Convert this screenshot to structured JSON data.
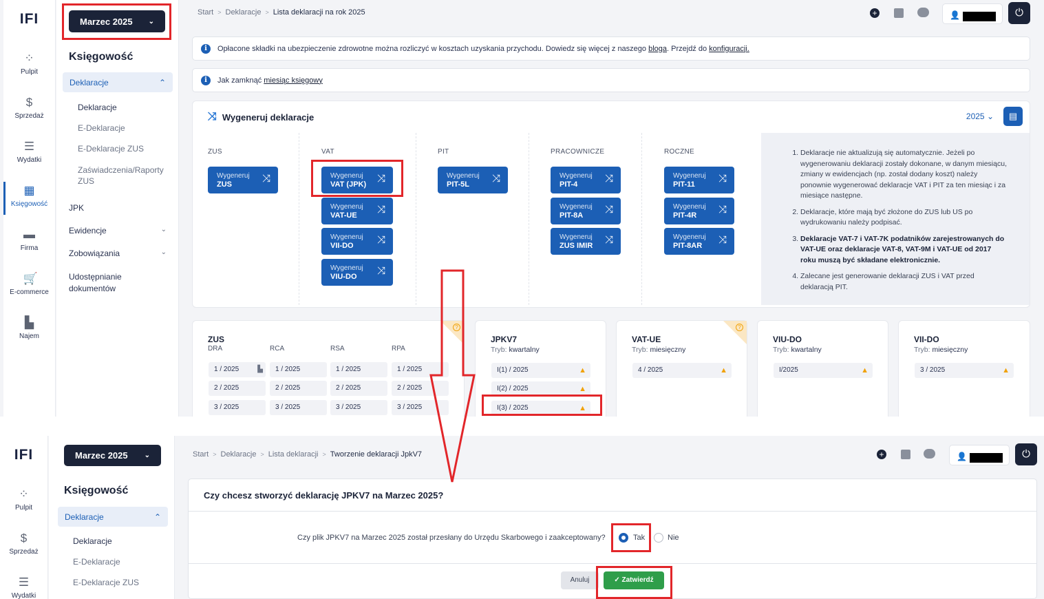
{
  "top": {
    "logo": "IFI",
    "month_button": "Marzec 2025",
    "rail": [
      {
        "label": "Pulpit",
        "icon": "dashboard-icon"
      },
      {
        "label": "Sprzedaż",
        "icon": "invoice-icon"
      },
      {
        "label": "Wydatki",
        "icon": "receipt-icon"
      },
      {
        "label": "Księgowość",
        "icon": "accounting-icon"
      },
      {
        "label": "Firma",
        "icon": "briefcase-icon"
      },
      {
        "label": "E-commerce",
        "icon": "cart-icon"
      },
      {
        "label": "Najem",
        "icon": "building-icon"
      }
    ],
    "side_title": "Księgowość",
    "side_selected": "Deklaracje",
    "side_sub": [
      "Deklaracje",
      "E-Deklaracje",
      "E-Deklaracje ZUS",
      "Zaświadczenia/Raporty",
      "ZUS"
    ],
    "side_main": [
      "JPK",
      "Ewidencje",
      "Zobowiązania",
      "Udostępnianie",
      "dokumentów"
    ],
    "breadcrumbs": [
      "Start",
      "Deklaracje",
      "Lista deklaracji na rok 2025"
    ],
    "info1": {
      "text": "Opłacone składki na ubezpieczenie zdrowotne można rozliczyć w kosztach uzyskania przychodu. Dowiedz się więcej z naszego",
      "link1": "bloga",
      "mid": ". Przejdź do",
      "link2": "konfiguracji."
    },
    "info2": {
      "text": "Jak zamknąć",
      "link": "miesiąc księgowy"
    },
    "gen_title": "Wygeneruj deklaracje",
    "year": "2025",
    "columns": [
      "ZUS",
      "VAT",
      "PIT",
      "PRACOWNICZE",
      "ROCZNE"
    ],
    "gen_prefix": "Wygeneruj",
    "buttons": {
      "zus": [
        "ZUS"
      ],
      "vat": [
        "VAT (JPK)",
        "VAT-UE",
        "VII-DO",
        "VIU-DO"
      ],
      "pit": [
        "PIT-5L"
      ],
      "prac": [
        "PIT-4",
        "PIT-8A",
        "ZUS IMIR"
      ],
      "roczne": [
        "PIT-11",
        "PIT-4R",
        "PIT-8AR"
      ]
    },
    "notes": {
      "n1": "Deklaracje nie aktualizują się automatycznie. Jeżeli po wygenerowaniu deklaracji zostały dokonane, w danym miesiącu, zmiany w ewidencjach (np. został dodany koszt) należy ponownie wygenerować deklaracje VAT i PIT za ten miesiąc i za miesiące następne.",
      "n2": "Deklaracje, które mają być złożone do ZUS lub US po wydrukowaniu należy podpisać.",
      "n3": "Deklaracje VAT-7 i VAT-7K podatników zarejestrowanych do VAT-UE oraz deklaracje VAT-8, VAT-9M i VAT-UE od 2017 roku muszą być składane elektronicznie.",
      "n4": "Zalecane jest generowanie deklaracji ZUS i VAT przed deklaracją PIT."
    },
    "zus_card": {
      "title": "ZUS",
      "cols": [
        "DRA",
        "RCA",
        "RSA",
        "RPA"
      ],
      "rows": [
        "1 / 2025",
        "2 / 2025",
        "3 / 2025"
      ]
    },
    "jpk_card": {
      "title": "JPKV7",
      "mode_label": "Tryb:",
      "mode": "kwartalny",
      "rows": [
        "I(1) / 2025",
        "I(2) / 2025",
        "I(3) / 2025"
      ]
    },
    "vatue_card": {
      "title": "VAT-UE",
      "mode_label": "Tryb:",
      "mode": "miesięczny",
      "rows": [
        "4 / 2025"
      ]
    },
    "viudo_card": {
      "title": "VIU-DO",
      "mode_label": "Tryb:",
      "mode": "kwartalny",
      "rows": [
        "I/2025"
      ]
    },
    "viido_card": {
      "title": "VII-DO",
      "mode_label": "Tryb:",
      "mode": "miesięczny",
      "rows": [
        "3 / 2025"
      ]
    }
  },
  "bottom": {
    "logo": "IFI",
    "month_button": "Marzec 2025",
    "rail": [
      {
        "label": "Pulpit",
        "icon": "dashboard-icon"
      },
      {
        "label": "Sprzedaż",
        "icon": "invoice-icon"
      },
      {
        "label": "Wydatki",
        "icon": "receipt-icon"
      }
    ],
    "side_title": "Księgowość",
    "side_selected": "Deklaracje",
    "side_sub": [
      "Deklaracje",
      "E-Deklaracje",
      "E-Deklaracje ZUS"
    ],
    "breadcrumbs": [
      "Start",
      "Deklaracje",
      "Lista deklaracji",
      "Tworzenie deklaracji JpkV7"
    ],
    "dialog": {
      "question": "Czy chcesz stworzyć deklarację JPKV7 na Marzec 2025?",
      "text": "Czy plik JPKV7 na Marzec 2025 został przesłany do Urzędu Skarbowego i zaakceptowany?",
      "yes": "Tak",
      "no": "Nie",
      "selected": "Tak",
      "cancel": "Anuluj",
      "confirm": "Zatwierdź"
    }
  },
  "colors": {
    "primary": "#1c5fb5",
    "dark": "#1b2338",
    "green": "#2f9e4a",
    "highlight": "#e2262a",
    "warning": "#f0a20a"
  }
}
